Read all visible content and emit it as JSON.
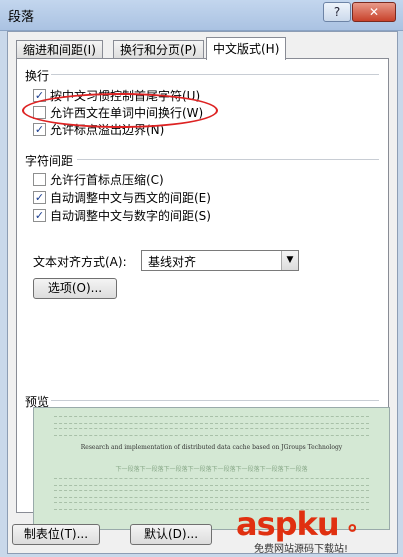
{
  "window": {
    "title": "段落",
    "help_icon": "?",
    "close_icon": "✕"
  },
  "tabs": [
    {
      "label": "缩进和间距(I)",
      "active": false
    },
    {
      "label": "换行和分页(P)",
      "active": false
    },
    {
      "label": "中文版式(H)",
      "active": true
    }
  ],
  "line_break": {
    "section_label": "换行",
    "options": [
      {
        "label": "按中文习惯控制首尾字符(U)",
        "checked": true
      },
      {
        "label": "允许西文在单词中间换行(W)",
        "checked": false
      },
      {
        "label": "允许标点溢出边界(N)",
        "checked": true
      }
    ]
  },
  "char_spacing": {
    "section_label": "字符间距",
    "options": [
      {
        "label": "允许行首标点压缩(C)",
        "checked": false
      },
      {
        "label": "自动调整中文与西文的间距(E)",
        "checked": true
      },
      {
        "label": "自动调整中文与数字的间距(S)",
        "checked": true
      }
    ]
  },
  "text_align": {
    "label": "文本对齐方式(A):",
    "value": "基线对齐",
    "arrow_icon": "▼"
  },
  "options_button": "选项(O)...",
  "preview": {
    "label": "预览",
    "sample_line1": "Research and implementation of distributed data cache based on JGroups Technology",
    "sample_line2": "下一段落下一段落下一段落下一段落下一段落下一段落下一段落下一段落"
  },
  "footer": {
    "tabs_button": "制表位(T)...",
    "default_button": "默认(D)..."
  },
  "watermark": {
    "main": "aspku",
    "glyph": "。",
    "sub": "免费网站源码下载站!"
  },
  "annotation_color": "#dd2222"
}
